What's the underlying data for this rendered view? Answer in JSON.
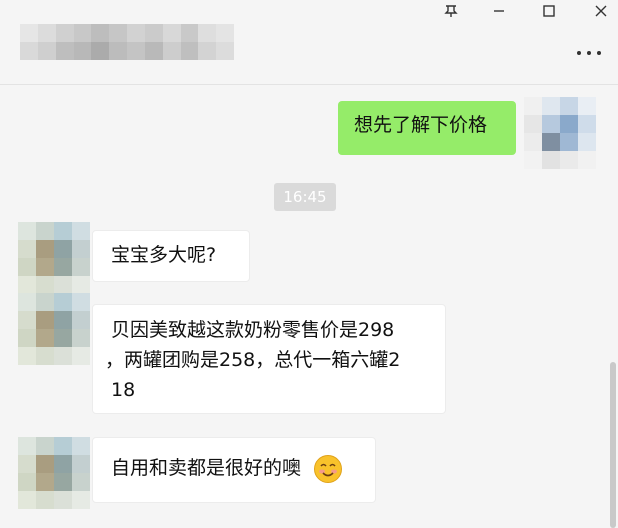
{
  "window": {
    "pin_icon": "pin-icon",
    "minimize_icon": "minimize-icon",
    "maximize_icon": "maximize-icon",
    "close_icon": "close-icon",
    "more_icon": "more-icon"
  },
  "titlebar": {
    "contact_name_note": ""
  },
  "messages": {
    "m1": {
      "text": "想先了解下价格"
    },
    "time": "16:45",
    "m2": {
      "text": "宝宝多大呢?"
    },
    "m3": {
      "line1": "贝因美致越这款奶粉零售价是298",
      "line2": "，两罐团购是258，总代一箱六罐2",
      "line3": "18"
    },
    "m4": {
      "text": "自用和卖都是很好的噢",
      "emoji": "smile-emoji"
    }
  },
  "colors": {
    "self_bubble": "#95ec69",
    "other_bubble": "#ffffff",
    "background": "#f5f5f5"
  }
}
